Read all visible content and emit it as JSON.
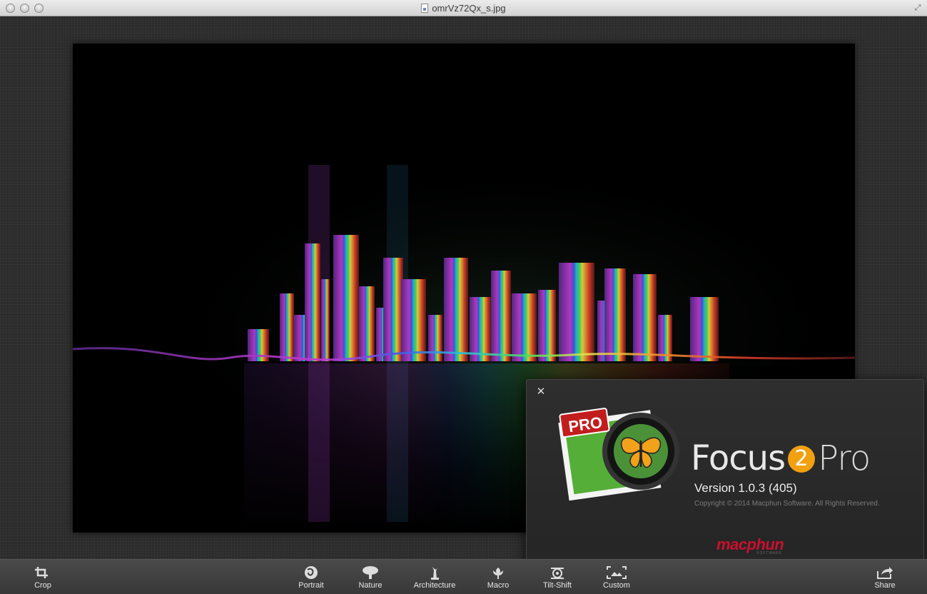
{
  "window": {
    "title": "omrVz72Qx_s.jpg"
  },
  "about": {
    "app_name": "Focus",
    "app_number": "2",
    "app_edition": "Pro",
    "icon_badge": "PRO",
    "version": "Version 1.0.3 (405)",
    "copyright": "Copyright © 2014 Macphun Software. All Rights Reserved.",
    "brand": "macphun",
    "brand_sub": "SOFTWARE",
    "accent": "#f0a011",
    "brand_color": "#c8102e"
  },
  "toolbar": {
    "crop": "Crop",
    "portrait": "Portrait",
    "nature": "Nature",
    "architecture": "Architecture",
    "macro": "Macro",
    "tilt_shift": "Tilt-Shift",
    "custom": "Custom",
    "share": "Share"
  }
}
